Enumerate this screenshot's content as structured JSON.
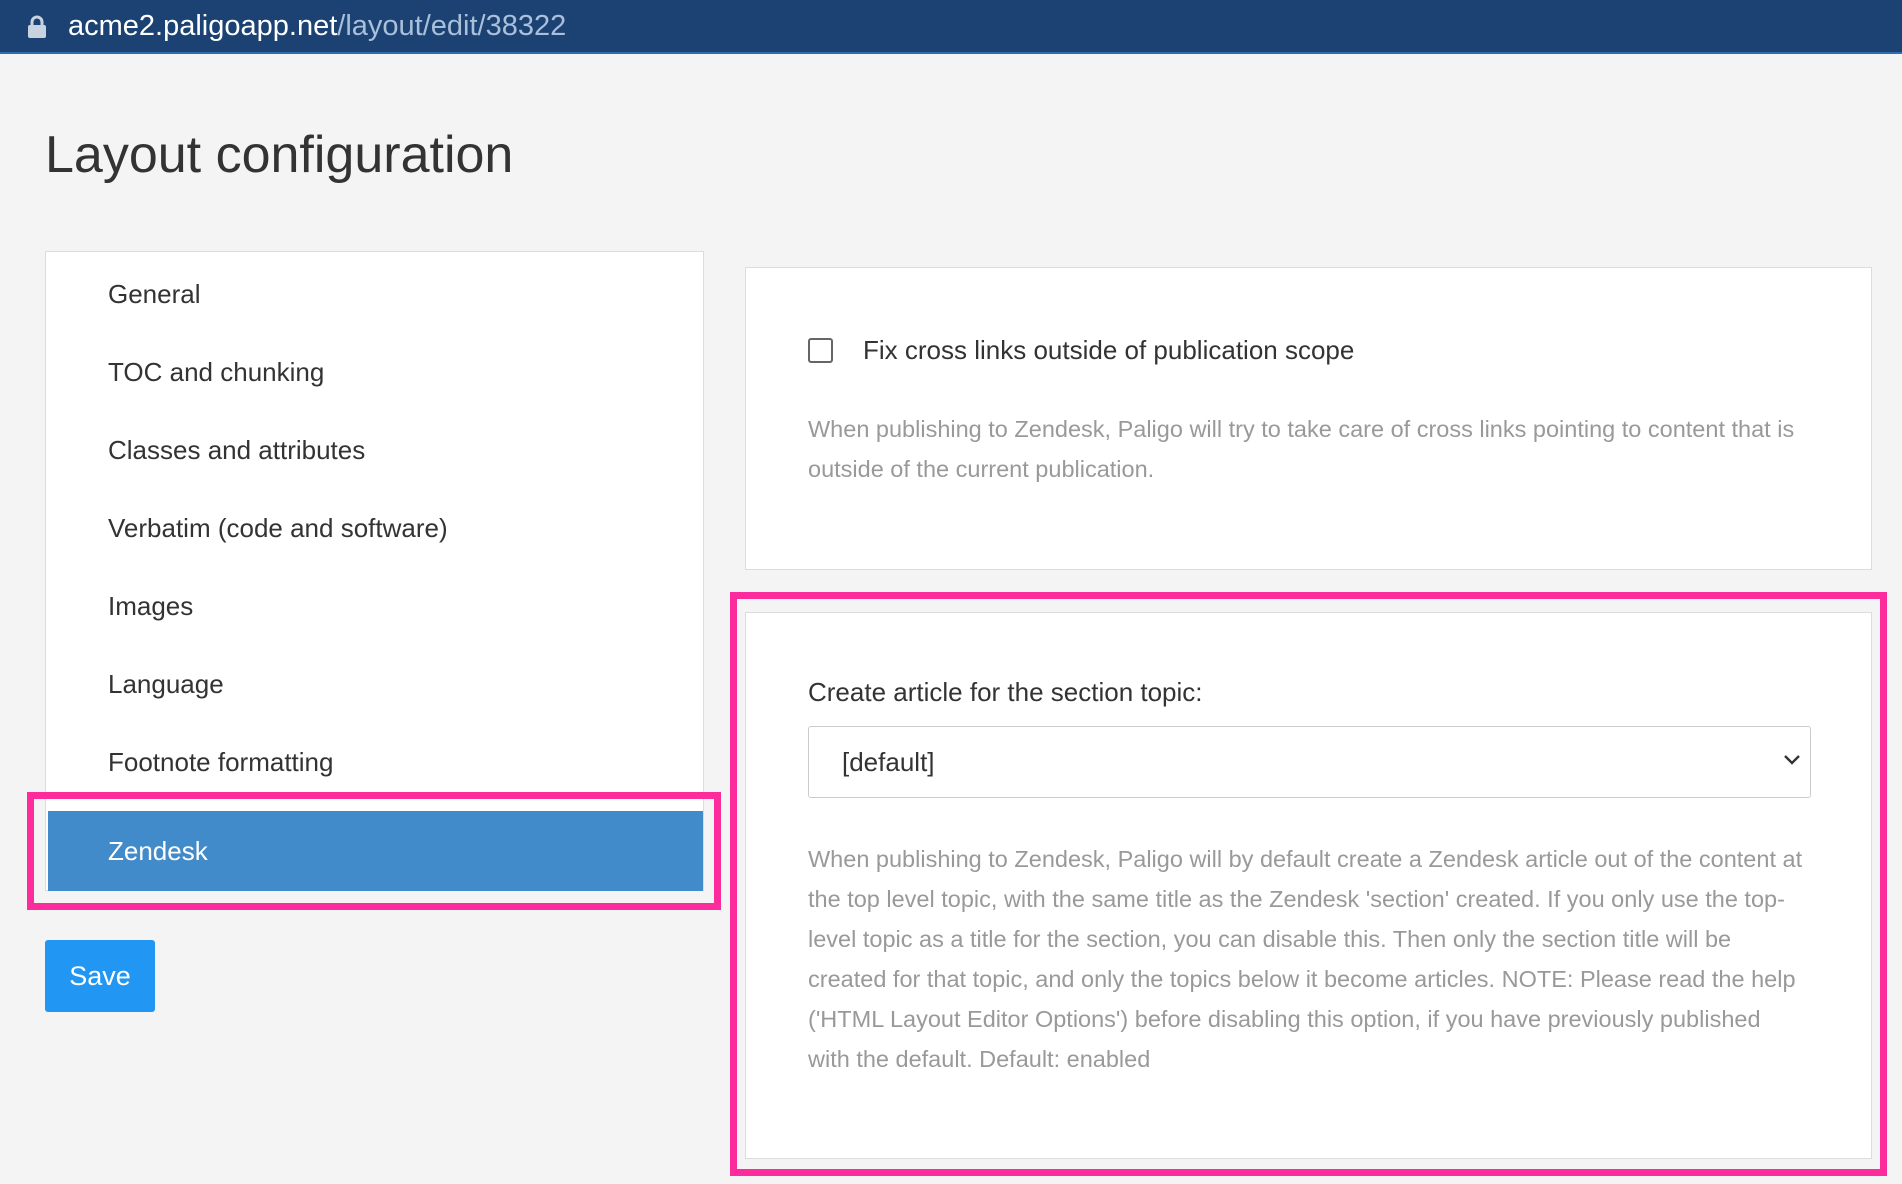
{
  "browser": {
    "url_host": "acme2.paligoapp.net",
    "url_path": "/layout/edit/38322"
  },
  "page": {
    "title": "Layout configuration"
  },
  "sidebar": {
    "items": [
      {
        "label": "General"
      },
      {
        "label": "TOC and chunking"
      },
      {
        "label": "Classes and attributes"
      },
      {
        "label": "Verbatim (code and software)"
      },
      {
        "label": "Images"
      },
      {
        "label": "Language"
      },
      {
        "label": "Footnote formatting"
      },
      {
        "label": "Zendesk",
        "active": true
      }
    ]
  },
  "save_button": {
    "label": "Save"
  },
  "cross_links": {
    "checkbox_label": "Fix cross links outside of publication scope",
    "checked": false,
    "help": "When publishing to Zendesk, Paligo will try to take care of cross links pointing to content that is outside of the current publication."
  },
  "section_topic": {
    "label": "Create article for the section topic:",
    "selected": "[default]",
    "help": "When publishing to Zendesk, Paligo will by default create a Zendesk article out of the content at the top level topic, with the same title as the Zendesk 'section' created. If you only use the top-level topic as a title for the section, you can disable this. Then only the section title will be created for that topic, and only the topics below it become articles. NOTE: Please read the help ('HTML Layout Editor Options') before disabling this option, if you have previously published with the default. Default: enabled"
  },
  "colors": {
    "url_bar": "#1b4272",
    "active_item": "#428bca",
    "save_button": "#2196f3",
    "highlight": "#fc2c9c",
    "page_background": "#f4f4f4"
  }
}
